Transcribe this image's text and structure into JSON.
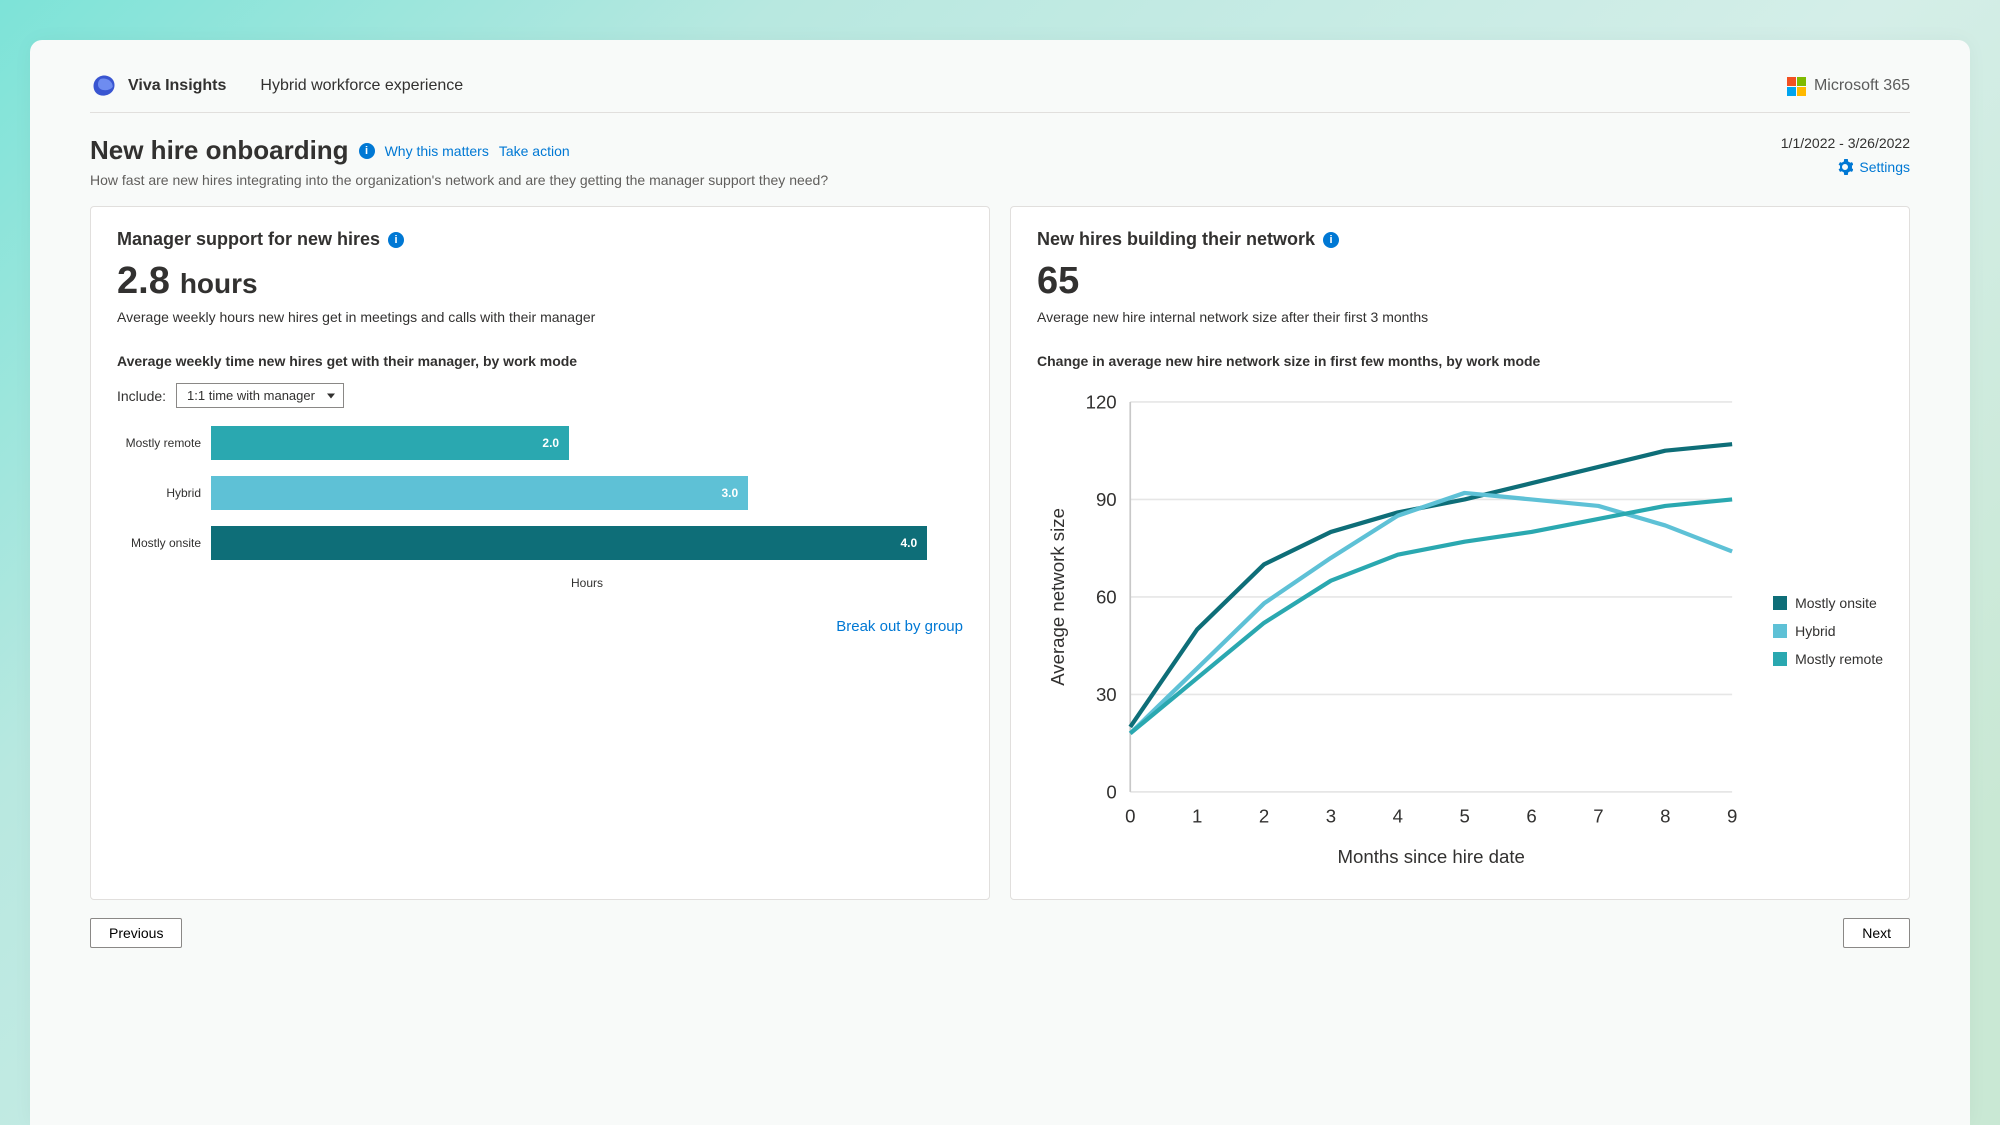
{
  "header": {
    "product": "Viva Insights",
    "context": "Hybrid workforce experience",
    "ms365_label": "Microsoft 365"
  },
  "page": {
    "title": "New hire onboarding",
    "why_link": "Why this matters",
    "action_link": "Take action",
    "subtitle": "How fast are new hires integrating into the organization's network and are they getting the manager support they need?",
    "date_range": "1/1/2022 - 3/26/2022",
    "settings_label": "Settings"
  },
  "card_manager": {
    "title": "Manager support for new hires",
    "stat_value": "2.8",
    "stat_unit": "hours",
    "stat_desc": "Average weekly hours new hires get in meetings and calls with their manager",
    "chart_title": "Average weekly time new hires get with their manager, by work mode",
    "include_label": "Include:",
    "include_value": "1:1 time with manager",
    "xlabel": "Hours",
    "bottom_link": "Break out by group"
  },
  "card_network": {
    "title": "New hires building their network",
    "stat_value": "65",
    "stat_desc": "Average new hire internal network size after their first 3 months",
    "chart_title": "Change in average new hire network size in first few months, by work mode",
    "ylabel": "Average network size",
    "xlabel": "Months since hire date"
  },
  "nav": {
    "prev": "Previous",
    "next": "Next"
  },
  "colors": {
    "mostly_remote": "#2aa8b0",
    "hybrid": "#5ec1d6",
    "mostly_onsite": "#0e6e78",
    "link": "#0078d4"
  },
  "chart_data": [
    {
      "type": "bar",
      "title": "Average weekly time new hires get with their manager, by work mode",
      "xlabel": "Hours",
      "ylabel": "",
      "xlim": [
        0,
        4.2
      ],
      "categories": [
        "Mostly remote",
        "Hybrid",
        "Mostly onsite"
      ],
      "values": [
        2.0,
        3.0,
        4.0
      ],
      "colors": [
        "#2aa8b0",
        "#5ec1d6",
        "#0e6e78"
      ]
    },
    {
      "type": "line",
      "title": "Change in average new hire network size in first few months, by work mode",
      "xlabel": "Months since hire date",
      "ylabel": "Average network size",
      "x": [
        0,
        1,
        2,
        3,
        4,
        5,
        6,
        7,
        8,
        9
      ],
      "xticks": [
        0,
        1,
        2,
        3,
        4,
        5,
        6,
        7,
        8,
        9
      ],
      "yticks": [
        0,
        30,
        60,
        90,
        120
      ],
      "ylim": [
        0,
        120
      ],
      "series": [
        {
          "name": "Mostly onsite",
          "color": "#0e6e78",
          "values": [
            20,
            50,
            70,
            80,
            86,
            90,
            95,
            100,
            105,
            107
          ]
        },
        {
          "name": "Hybrid",
          "color": "#5ec1d6",
          "values": [
            18,
            38,
            58,
            72,
            85,
            92,
            90,
            88,
            82,
            74
          ]
        },
        {
          "name": "Mostly remote",
          "color": "#2aa8b0",
          "values": [
            18,
            35,
            52,
            65,
            73,
            77,
            80,
            84,
            88,
            90
          ]
        }
      ],
      "legend": [
        "Mostly onsite",
        "Hybrid",
        "Mostly remote"
      ]
    }
  ]
}
